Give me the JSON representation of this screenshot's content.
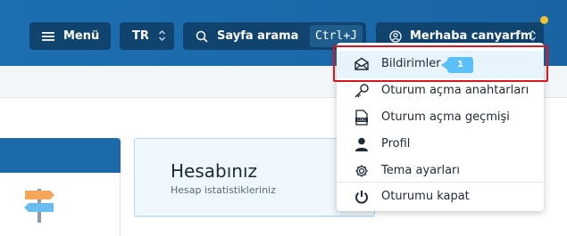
{
  "header": {
    "menu_label": "Menü",
    "lang_label": "TR",
    "search_label": "Sayfa arama",
    "search_shortcut": "Ctrl+J",
    "user_greeting": "Merhaba canyarfm"
  },
  "account_card": {
    "title": "Hesabınız",
    "subtitle": "Hesap istatistikleriniz"
  },
  "user_menu": {
    "items": [
      {
        "label": "Bildirimler",
        "icon": "envelope-icon",
        "badge": "1",
        "active": true
      },
      {
        "label": "Oturum açma anahtarları",
        "icon": "key-icon"
      },
      {
        "label": "Oturum açma geçmişi",
        "icon": "log-icon"
      },
      {
        "label": "Profil",
        "icon": "user-icon"
      },
      {
        "label": "Tema ayarları",
        "icon": "gear-icon"
      },
      {
        "label": "Oturumu kapat",
        "icon": "power-icon"
      }
    ]
  },
  "colors": {
    "header_bg": "#1d6fb1",
    "button_bg": "#10446f",
    "notification_dot": "#f2c12e",
    "badge_bg": "#5bc0f8",
    "highlight_border": "#d9171f"
  }
}
